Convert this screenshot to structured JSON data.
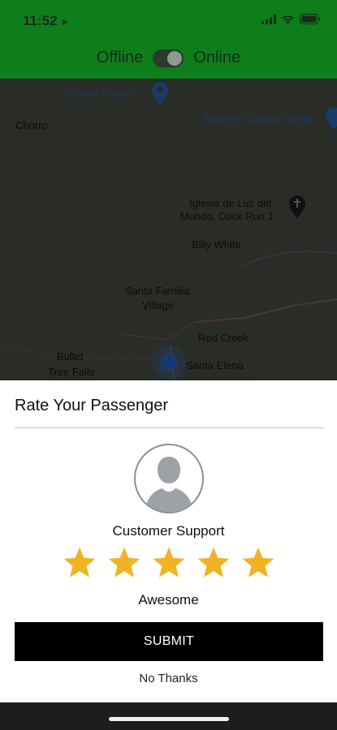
{
  "status_bar": {
    "time": "11:52",
    "location_icon": "location-arrow-icon",
    "signal_icon": "cellular-signal-icon",
    "wifi_icon": "wifi-icon",
    "battery_icon": "battery-icon"
  },
  "header": {
    "offline_label": "Offline",
    "online_label": "Online",
    "toggle_on": true,
    "bar_color": "#0d7e1a"
  },
  "map": {
    "places": {
      "sunrise": "Sunrise Reach",
      "chorro": "Chorro",
      "farmers": "Farmers Trading Center",
      "iglesia_1": "Iglesia de Luz del",
      "iglesia_2": "Mundo, Dock Run 1",
      "billy": "Billy White",
      "santa_familia_1": "Santa Familia",
      "santa_familia_2": "Village",
      "red_creek": "Red Creek",
      "bullet_1": "Bullet",
      "bullet_2": "Tree Falls",
      "santa_elena": "Santa Elena"
    }
  },
  "rating_sheet": {
    "title": "Rate Your Passenger",
    "avatar_icon": "person-silhouette-icon",
    "passenger_name": "Customer Support",
    "stars_total": 5,
    "stars_selected": 5,
    "star_color": "#f0b323",
    "rating_label": "Awesome",
    "submit_label": "SUBMIT",
    "dismiss_label": "No Thanks"
  }
}
